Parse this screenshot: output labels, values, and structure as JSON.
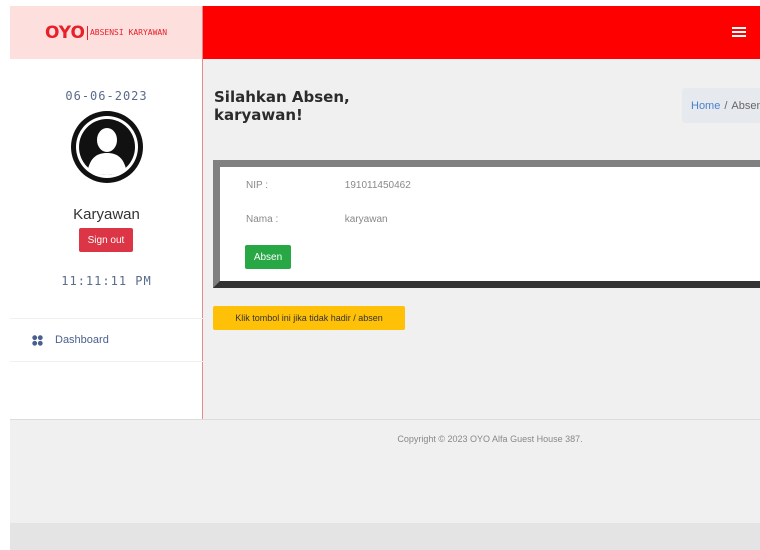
{
  "brand": {
    "logo": "OYO",
    "subtitle": "ABSENSI KARYAWAN"
  },
  "sidebar": {
    "date": "06-06-2023",
    "username": "Karyawan",
    "signout_label": "Sign out",
    "clock": "11:11:11 PM",
    "nav": [
      {
        "label": "Dashboard",
        "icon": "dashboard-icon"
      }
    ]
  },
  "header": {
    "menu_icon": "hamburger-icon"
  },
  "main": {
    "title_line1": "Silahkan Absen,",
    "title_line2": "karyawan!",
    "breadcrumb": {
      "home": "Home",
      "separator": "/",
      "current": "Absen"
    },
    "form": {
      "nip_label": "NIP :",
      "nip_value": "191011450462",
      "nama_label": "Nama :",
      "nama_value": "karyawan",
      "absen_label": "Absen"
    },
    "not_present_label": "Klik tombol ini jika tidak hadir / absen"
  },
  "footer": {
    "copyright": "Copyright © 2023 OYO Alfa Guest House 387."
  },
  "colors": {
    "topbar": "#fe0000",
    "brand": "#e8202a",
    "brand_bg": "#fde0de",
    "signout": "#dc3545",
    "absen": "#28a745",
    "warning": "#ffc107",
    "link": "#4a7fd1"
  }
}
